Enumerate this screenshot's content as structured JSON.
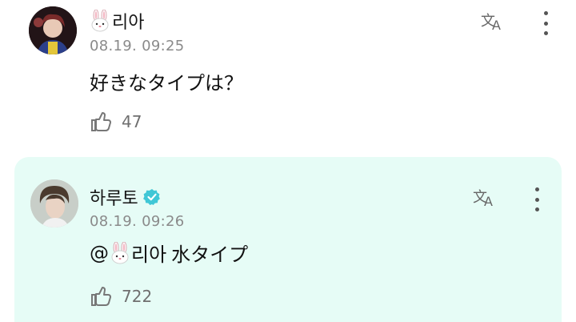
{
  "comments": [
    {
      "author": "리아",
      "author_emoji": "bunny-face",
      "timestamp": "08.19. 09:25",
      "text": "好きなタイプは？",
      "likes": "47",
      "verified": false
    },
    {
      "author": "하루토",
      "timestamp": "08.19. 09:26",
      "mention": "@",
      "mention_name": "리아",
      "text": "水タイプ",
      "likes": "722",
      "verified": true
    }
  ],
  "colors": {
    "reply_background": "#e6fcf6",
    "verified_badge": "#3fc7d6",
    "timestamp": "#8a8a8a"
  },
  "icons": [
    "translate-icon",
    "more-vertical-icon",
    "like-heart-hand-icon",
    "verified-badge-icon",
    "bunny-emoji"
  ]
}
